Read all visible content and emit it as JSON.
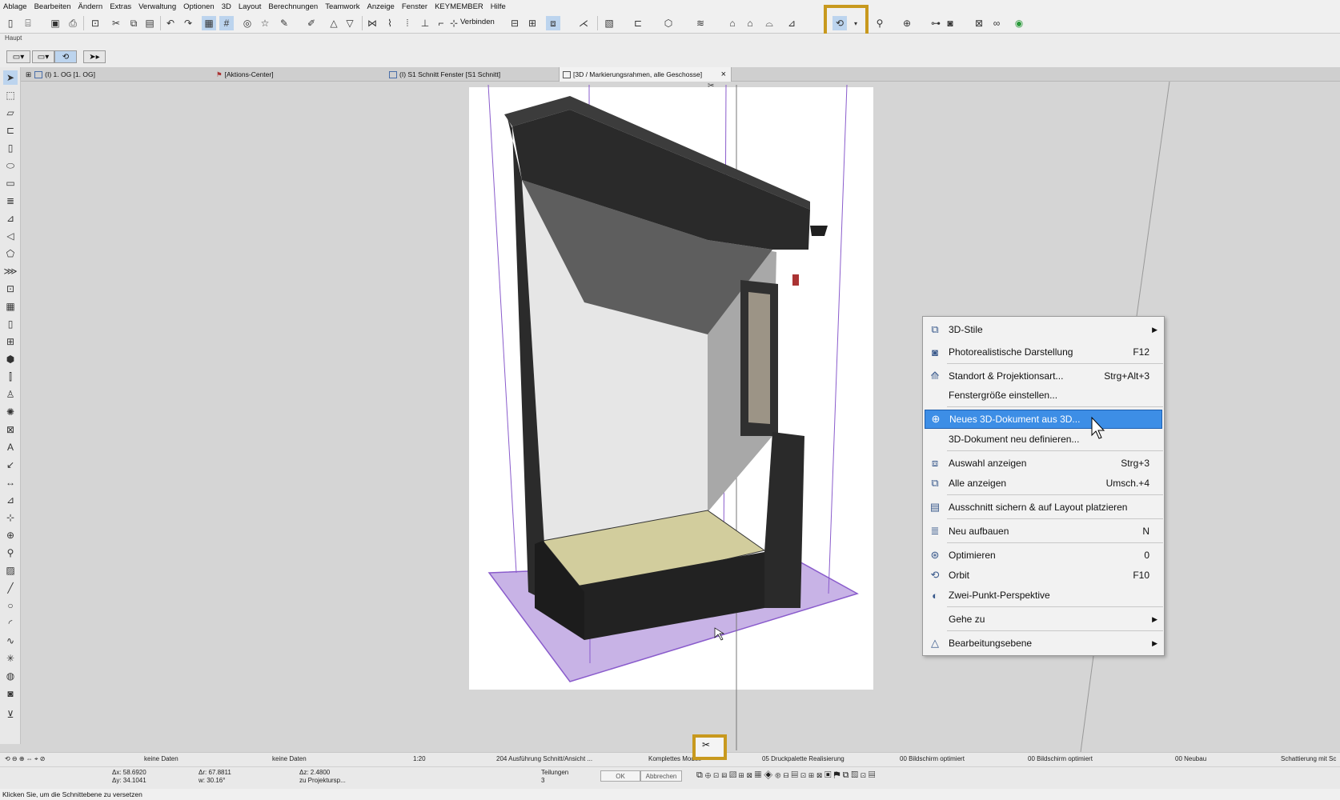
{
  "menubar": [
    "Ablage",
    "Bearbeiten",
    "Ändern",
    "Extras",
    "Verwaltung",
    "Optionen",
    "3D",
    "Layout",
    "Berechnungen",
    "Teamwork",
    "Anzeige",
    "Fenster",
    "KEYMEMBER",
    "Hilfe"
  ],
  "toolbar": {
    "verbinden_label": "Verbinden"
  },
  "toolbar2": {
    "group_label": "Haupt"
  },
  "tabs": [
    {
      "label": "(I) 1. OG [1. OG]"
    },
    {
      "label": "[Aktions-Center]"
    },
    {
      "label": "(I) S1 Schnitt Fenster [S1 Schnitt]"
    },
    {
      "label": "[3D / Markierungsrahmen, alle Geschosse]",
      "close": "×"
    }
  ],
  "context_menu": {
    "items": [
      {
        "icon": "3d-styles-icon",
        "label": "3D-Stile",
        "shortcut": "",
        "submenu": true
      },
      {
        "icon": "camera-icon",
        "label": "Photorealistische Darstellung",
        "shortcut": "F12",
        "submenu": false
      },
      {
        "icon": "projection-icon",
        "label": "Standort & Projektionsart...",
        "shortcut": "Strg+Alt+3",
        "submenu": false
      },
      {
        "icon": "",
        "label": "Fenstergröße einstellen...",
        "shortcut": "",
        "submenu": false
      },
      {
        "icon": "new-3d-document-icon",
        "label": "Neues 3D-Dokument aus 3D...",
        "shortcut": "",
        "submenu": false,
        "highlighted": true
      },
      {
        "icon": "",
        "label": "3D-Dokument neu definieren...",
        "shortcut": "",
        "submenu": false
      },
      {
        "icon": "show-selection-icon",
        "label": "Auswahl anzeigen",
        "shortcut": "Strg+3",
        "submenu": false
      },
      {
        "icon": "show-all-icon",
        "label": "Alle anzeigen",
        "shortcut": "Umsch.+4",
        "submenu": false
      },
      {
        "icon": "save-view-icon",
        "label": "Ausschnitt sichern & auf Layout platzieren",
        "shortcut": "",
        "submenu": false
      },
      {
        "icon": "rebuild-icon",
        "label": "Neu aufbauen",
        "shortcut": "N",
        "submenu": false
      },
      {
        "icon": "optimize-icon",
        "label": "Optimieren",
        "shortcut": "0",
        "submenu": false
      },
      {
        "icon": "orbit-icon",
        "label": "Orbit",
        "shortcut": "F10",
        "submenu": false
      },
      {
        "icon": "two-point-perspective-icon",
        "label": "Zwei-Punkt-Perspektive",
        "shortcut": "",
        "submenu": false
      },
      {
        "icon": "",
        "label": "Gehe zu",
        "shortcut": "",
        "submenu": true
      },
      {
        "icon": "edit-plane-icon",
        "label": "Bearbeitungsebene",
        "shortcut": "",
        "submenu": true
      }
    ]
  },
  "status": {
    "no_data_1": "keine Daten",
    "no_data_2": "keine Daten",
    "scale": "1:20",
    "view_set": "204 Ausführung Schnitt/Ansicht ...",
    "model": "Komplettes Modell",
    "pen_set": "05 Druckpalette Realisierung",
    "screen_1": "00 Bildschirm optimiert",
    "screen_2": "00 Bildschirm optimiert",
    "renovation": "00 Neubau",
    "shading": "Schattierung mit Sc",
    "coord_x": "Δx: 58.6920",
    "coord_y": "Δy: 34.1041",
    "coord_r": "Δr: 67.8811",
    "coord_w": "w: 30.16°",
    "coord_z": "Δz: 2.4800",
    "projection_label": "zu Projektursp...",
    "divisions_label": "Teilungen",
    "divisions_value": "3",
    "ok": "OK",
    "cancel": "Abbrechen"
  },
  "hint": "Klicken Sie, um die Schnittebene zu versetzen",
  "colors": {
    "highlight_frame": "#c8991e",
    "menu_selection": "#3d8ee6",
    "section_box": "#9a6fd0"
  }
}
